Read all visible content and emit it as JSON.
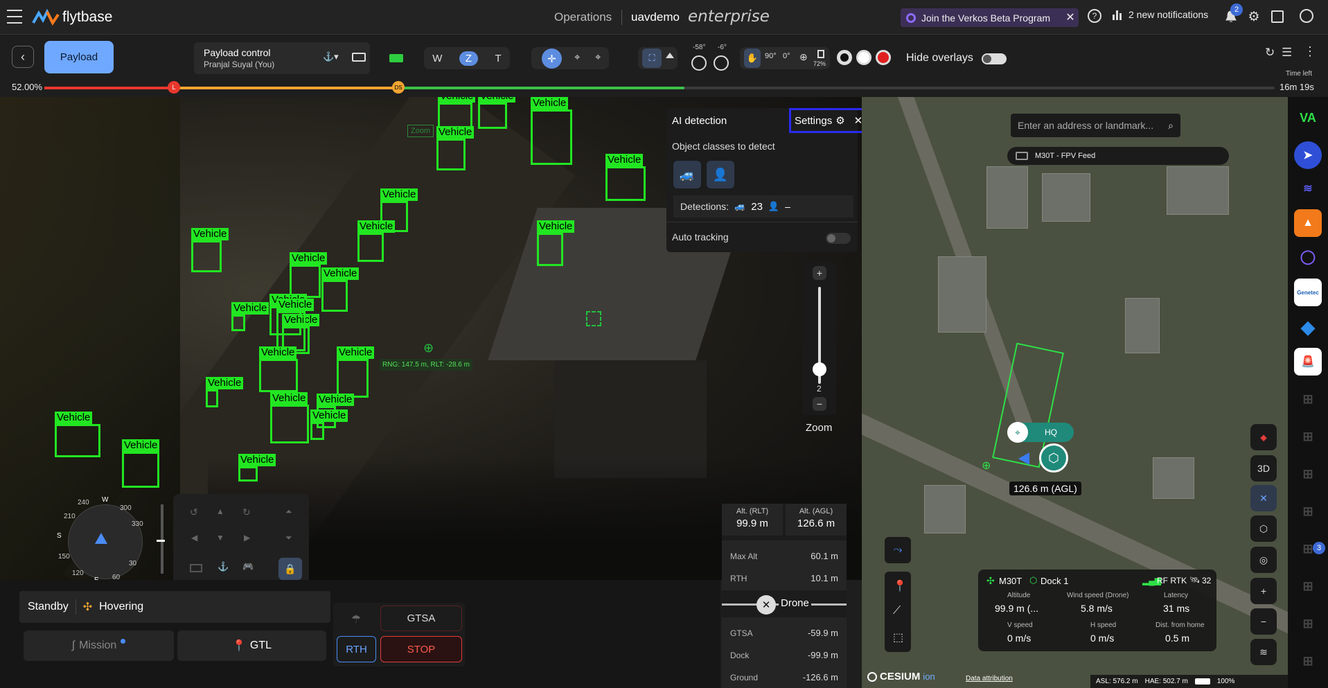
{
  "topbar": {
    "brand": "flytbase",
    "operations": "Operations",
    "org": "uavdemo",
    "enterprise": "enterprise",
    "beta": "Join the Verkos Beta Program",
    "notifications": "2 new notifications",
    "notif_count": "2"
  },
  "toolbar": {
    "payload": "Payload",
    "control_title": "Payload control",
    "control_user": "Pranjal Suyal (You)",
    "lens": [
      "W",
      "Z",
      "T"
    ],
    "angle1": "-58°",
    "angle2": "-6°",
    "rot1": "90°",
    "rot2": "0°",
    "battery_pct": "72%",
    "hide_overlays": "Hide overlays",
    "time_left_label": "Time left",
    "time_left": "16m 19s"
  },
  "progress": {
    "value": "52.00%",
    "marker_l": "L",
    "marker_ds": "DS",
    "fill": 0.52
  },
  "video": {
    "zoom_tag": "Zoom",
    "range": "RNG: 147.5 m, RLT: -28.6 m",
    "vehicle_label": "Vehicle"
  },
  "ai": {
    "title": "AI detection",
    "settings": "Settings",
    "classes_label": "Object classes to detect",
    "detections_label": "Detections:",
    "vehicle_count": "23",
    "person_count": "–",
    "auto_tracking": "Auto tracking",
    "zoom_value": "2",
    "zoom_label": "Zoom"
  },
  "compass": {
    "w": "W",
    "n240": "240",
    "n300": "300",
    "n210": "210",
    "n330": "330",
    "s": "S",
    "n150": "150",
    "n30": "30",
    "n120": "120",
    "n60": "60",
    "e": "E"
  },
  "alt": {
    "rlt_label": "Alt. (RLT)",
    "rlt": "99.9 m",
    "agl_label": "Alt. (AGL)",
    "agl": "126.6 m",
    "max_alt_label": "Max Alt",
    "max_alt": "60.1 m",
    "rth_label": "RTH",
    "rth": "10.1 m",
    "drone_label": "Drone",
    "gtsa_label": "GTSA",
    "gtsa": "-59.9 m",
    "dock_label": "Dock",
    "dock": "-99.9 m",
    "ground_label": "Ground",
    "ground": "-126.6 m"
  },
  "status": {
    "standby": "Standby",
    "hovering": "Hovering",
    "mission": "Mission",
    "gtl": "GTL",
    "gtsa": "GTSA",
    "rth": "RTH",
    "stop": "STOP"
  },
  "map": {
    "search_placeholder": "Enter an address or landmark...",
    "feed": "M30T - FPV Feed",
    "hq": "HQ",
    "agl_tag": "126.6 m (AGL)",
    "drone": "M30T",
    "dock": "Dock 1",
    "rtk": "RF RTK",
    "sats": "32",
    "altitude_label": "Altitude",
    "altitude": "99.9 m (...",
    "wind_label": "Wind speed (Drone)",
    "wind": "5.8 m/s",
    "latency_label": "Latency",
    "latency": "31 ms",
    "vspeed_label": "V speed",
    "vspeed": "0 m/s",
    "hspeed_label": "H speed",
    "hspeed": "0 m/s",
    "dist_label": "Dist. from home",
    "dist": "0.5 m",
    "btn_3d": "3D",
    "cesium": "CESIUM",
    "ion": "ion",
    "attribution": "Data attribution",
    "asl": "ASL: 576.2 m",
    "hae": "HAE: 502.7 m",
    "map_battery": "100%"
  },
  "rail": {
    "badge": "3",
    "genetec": "Genetec"
  }
}
